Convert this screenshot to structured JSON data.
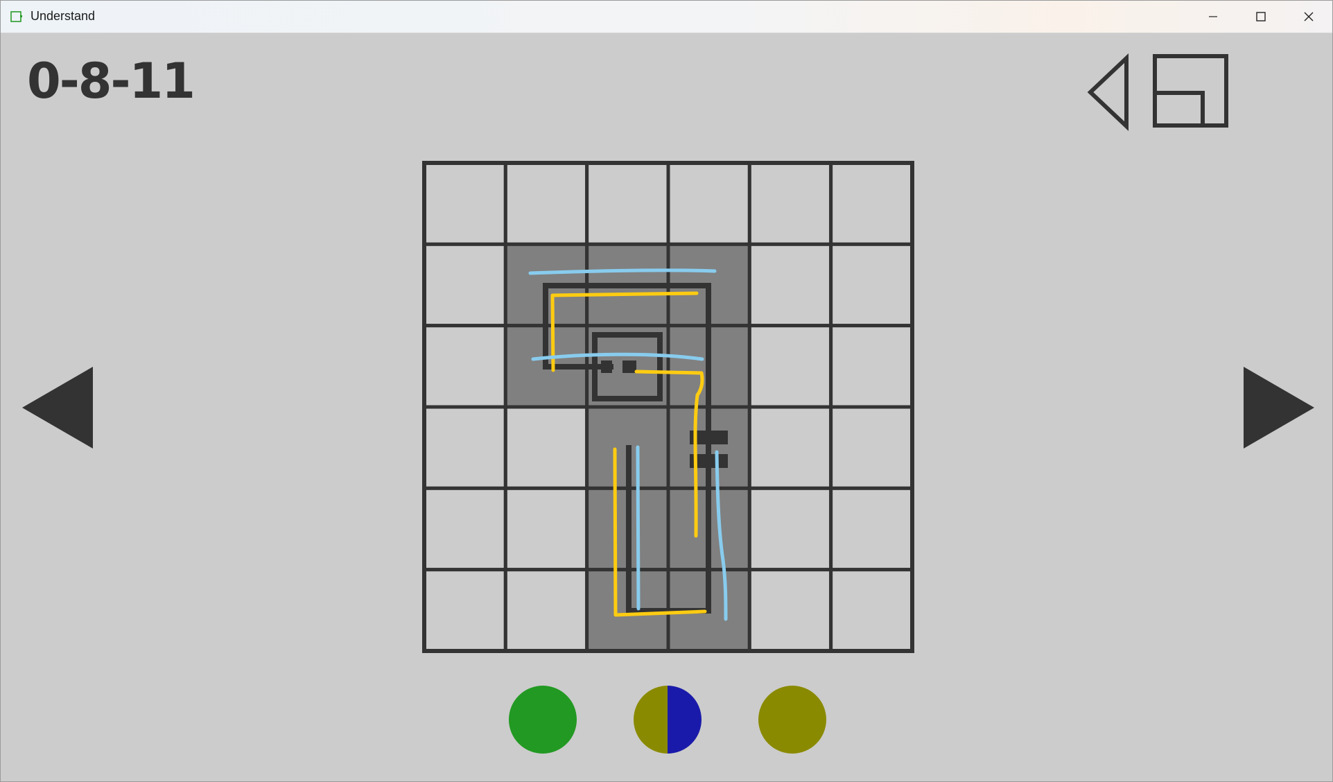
{
  "window": {
    "title": "Understand",
    "icons": {
      "app": "app-window-icon",
      "minimize": "minimize-icon",
      "maximize": "maximize-icon",
      "close": "close-icon"
    }
  },
  "game": {
    "level_code": "0-8-11",
    "toolbar_icons": [
      "sound-icon",
      "fullscreen-icon",
      "exit-icon"
    ],
    "nav_icons": [
      "previous-level-icon",
      "next-level-icon"
    ],
    "grid": {
      "rows": 6,
      "cols": 6,
      "shaded_cells": [
        [
          1,
          1
        ],
        [
          1,
          2
        ],
        [
          1,
          3
        ],
        [
          2,
          1
        ],
        [
          2,
          2
        ],
        [
          2,
          3
        ],
        [
          3,
          2
        ],
        [
          3,
          3
        ],
        [
          4,
          2
        ],
        [
          4,
          3
        ],
        [
          5,
          2
        ],
        [
          5,
          3
        ]
      ]
    },
    "indicators": [
      {
        "name": "indicator-green",
        "colors": [
          "#229922"
        ]
      },
      {
        "name": "indicator-olive-blue",
        "colors": [
          "#8a8a00",
          "#1a1aaa"
        ]
      },
      {
        "name": "indicator-olive",
        "colors": [
          "#8a8a00"
        ]
      }
    ],
    "colors": {
      "background": "#cccccc",
      "cell_light": "#cccccc",
      "cell_shaded": "#808080",
      "grid_line": "#333333",
      "pen_yellow": "#ffcc11",
      "pen_blue": "#88ccee"
    }
  }
}
